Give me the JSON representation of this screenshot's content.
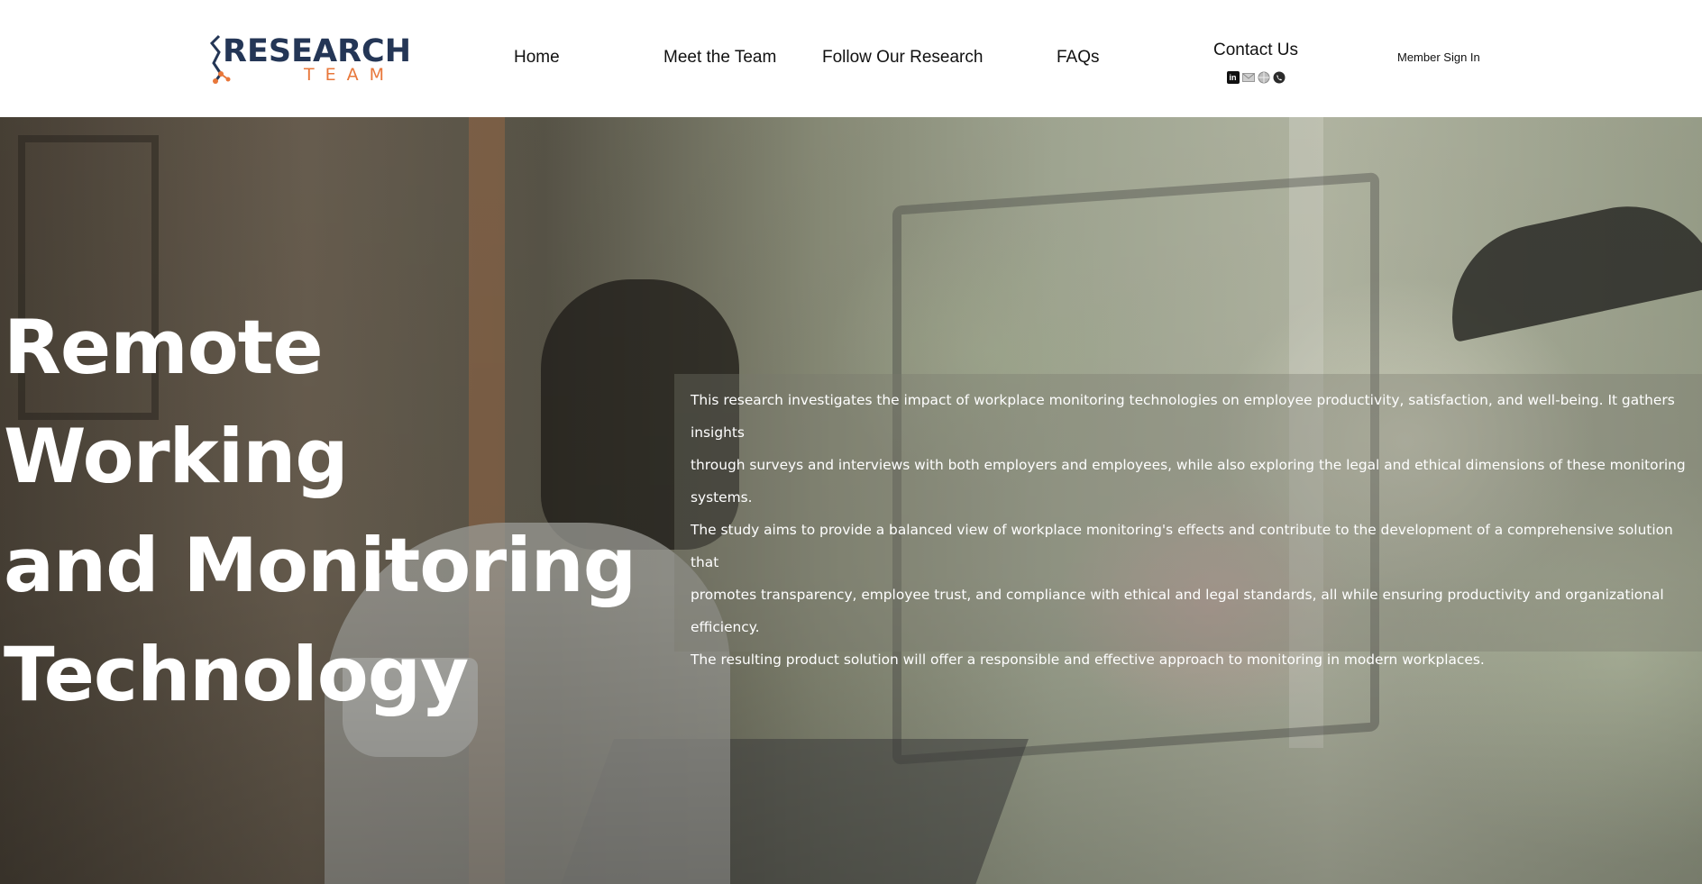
{
  "header": {
    "logo": {
      "main": "RESEARCH",
      "sub": "TEAM"
    },
    "nav": {
      "home": "Home",
      "team": "Meet the Team",
      "research": "Follow Our Research",
      "faqs": "FAQs",
      "contact": "Contact Us"
    },
    "social_icons": [
      "linkedin-icon",
      "email-icon",
      "website-icon",
      "phone-icon"
    ],
    "member_sign_in": "Member Sign In"
  },
  "hero": {
    "title_lines": [
      "Remote Working",
      "and Monitoring",
      "Technology"
    ],
    "description_lines": [
      "This research investigates the impact of workplace monitoring technologies on employee productivity, satisfaction, and well-being. It gathers insights",
      "through surveys and interviews with both employers and employees, while also exploring the legal and ethical dimensions of these monitoring systems.",
      "The study aims to provide a balanced view of workplace monitoring's effects and contribute to the development of a comprehensive solution that",
      "promotes transparency, employee trust, and compliance with ethical and legal standards, all while ensuring productivity and organizational efficiency.",
      "The resulting product solution will offer a responsible and effective approach to monitoring in modern workplaces."
    ]
  },
  "colors": {
    "logo_navy": "#243656",
    "logo_orange": "#e8773a",
    "hero_text": "#ffffff"
  }
}
